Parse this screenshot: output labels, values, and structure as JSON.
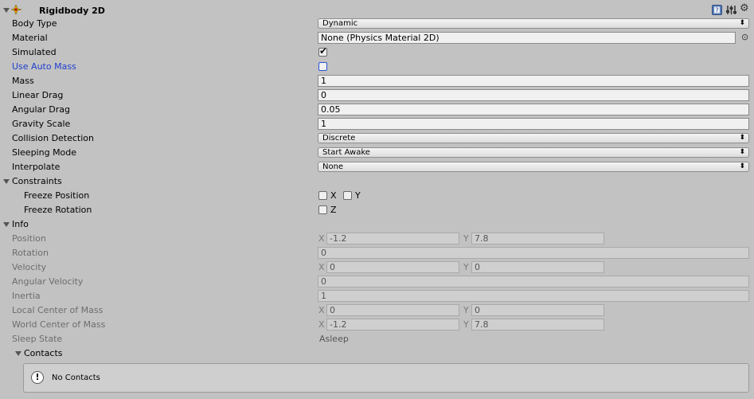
{
  "component": {
    "title": "Rigidbody 2D"
  },
  "fields": {
    "body_type": {
      "label": "Body Type",
      "value": "Dynamic"
    },
    "material": {
      "label": "Material",
      "value": "None (Physics Material 2D)"
    },
    "simulated": {
      "label": "Simulated",
      "checked": true
    },
    "use_auto_mass": {
      "label": "Use Auto Mass",
      "checked": false
    },
    "mass": {
      "label": "Mass",
      "value": "1"
    },
    "linear_drag": {
      "label": "Linear Drag",
      "value": "0"
    },
    "angular_drag": {
      "label": "Angular Drag",
      "value": "0.05"
    },
    "gravity_scale": {
      "label": "Gravity Scale",
      "value": "1"
    },
    "collision_detection": {
      "label": "Collision Detection",
      "value": "Discrete"
    },
    "sleeping_mode": {
      "label": "Sleeping Mode",
      "value": "Start Awake"
    },
    "interpolate": {
      "label": "Interpolate",
      "value": "None"
    }
  },
  "constraints": {
    "label": "Constraints",
    "freeze_position": {
      "label": "Freeze Position",
      "x_label": "X",
      "y_label": "Y"
    },
    "freeze_rotation": {
      "label": "Freeze Rotation",
      "z_label": "Z"
    }
  },
  "info": {
    "label": "Info",
    "axis_x": "X",
    "axis_y": "Y",
    "position": {
      "label": "Position",
      "x": "-1.2",
      "y": "7.8"
    },
    "rotation": {
      "label": "Rotation",
      "value": "0"
    },
    "velocity": {
      "label": "Velocity",
      "x": "0",
      "y": "0"
    },
    "angular_velocity": {
      "label": "Angular Velocity",
      "value": "0"
    },
    "inertia": {
      "label": "Inertia",
      "value": "1"
    },
    "local_center_of_mass": {
      "label": "Local Center of Mass",
      "x": "0",
      "y": "0"
    },
    "world_center_of_mass": {
      "label": "World Center of Mass",
      "x": "-1.2",
      "y": "7.8"
    },
    "sleep_state": {
      "label": "Sleep State",
      "value": "Asleep"
    },
    "contacts": {
      "label": "Contacts",
      "message": "No Contacts"
    }
  },
  "icons": {
    "component": "rigidbody2d-icon",
    "help": "help-book-icon",
    "presets": "presets-icon",
    "settings": "gear-icon",
    "object_picker": "object-picker-icon",
    "info": "info-icon"
  },
  "colors": {
    "background": "#c2c2c2",
    "highlight_label": "#1f3fd0"
  }
}
